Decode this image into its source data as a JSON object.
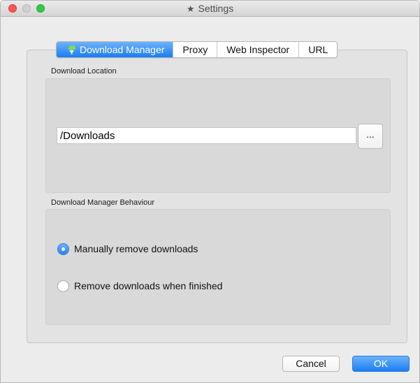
{
  "window": {
    "title": "Settings"
  },
  "tabs": [
    {
      "label": "Download Manager",
      "active": true
    },
    {
      "label": "Proxy",
      "active": false
    },
    {
      "label": "Web Inspector",
      "active": false
    },
    {
      "label": "URL",
      "active": false
    }
  ],
  "download_location": {
    "label": "Download Location",
    "path_value": "/Downloads",
    "browse_label": "..."
  },
  "behaviour": {
    "label": "Download Manager Behaviour",
    "options": [
      {
        "label": "Manually remove downloads",
        "selected": true
      },
      {
        "label": "Remove downloads when finished",
        "selected": false
      }
    ]
  },
  "footer": {
    "cancel_label": "Cancel",
    "ok_label": "OK"
  },
  "colors": {
    "accent": "#1a7cf2",
    "close": "#fc5753",
    "maximize": "#34c84a"
  }
}
